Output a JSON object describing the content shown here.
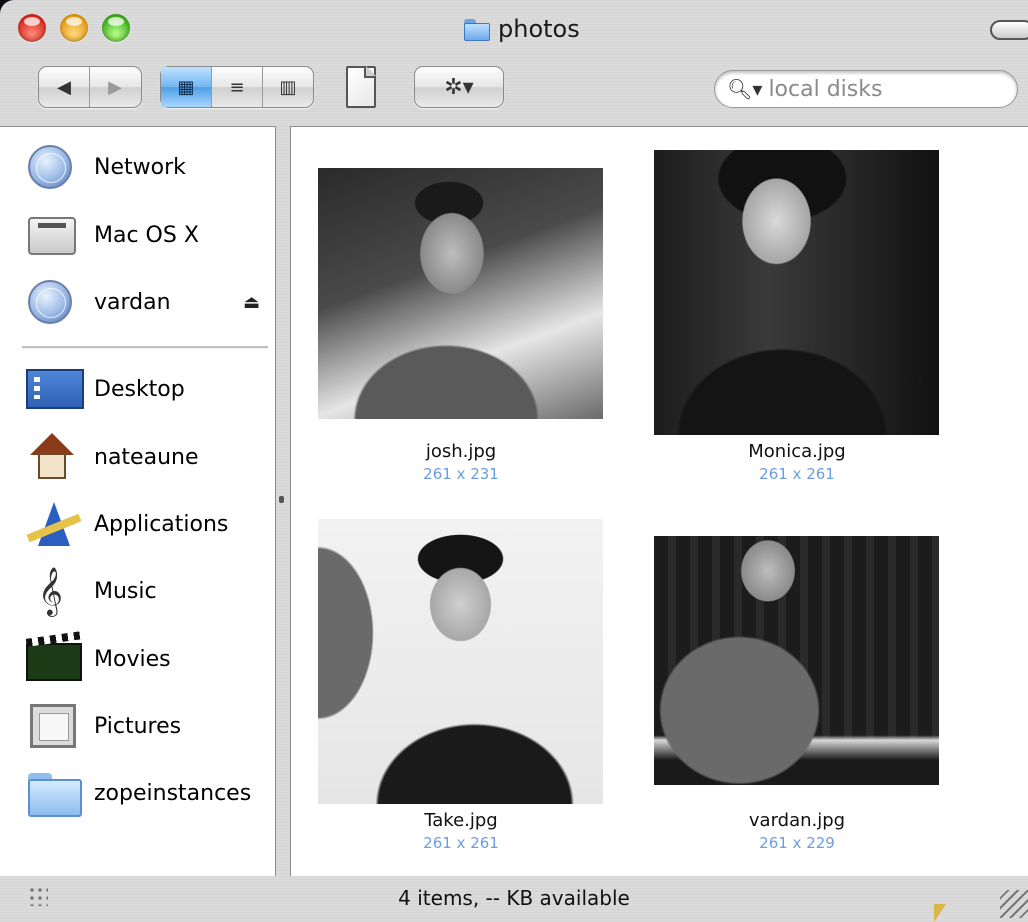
{
  "window": {
    "title": "photos"
  },
  "toolbar": {
    "back_glyph": "◀",
    "forward_glyph": "▶",
    "view_icon_glyph": "▦",
    "view_list_glyph": "≡",
    "view_column_glyph": "▥",
    "action_glyph": "✲▾",
    "search_placeholder": "local disks",
    "search_glyph": "🔍︎▾"
  },
  "sidebar": {
    "devices": [
      {
        "label": "Network",
        "icon": "network-globe-icon"
      },
      {
        "label": "Mac OS X",
        "icon": "hard-disk-icon"
      },
      {
        "label": "vardan",
        "icon": "server-globe-icon",
        "eject": "⏏"
      }
    ],
    "places": [
      {
        "label": "Desktop",
        "icon": "desktop-icon"
      },
      {
        "label": "nateaune",
        "icon": "home-icon"
      },
      {
        "label": "Applications",
        "icon": "applications-icon"
      },
      {
        "label": "Music",
        "icon": "music-icon"
      },
      {
        "label": "Movies",
        "icon": "movies-icon"
      },
      {
        "label": "Pictures",
        "icon": "pictures-icon"
      },
      {
        "label": "zopeinstances",
        "icon": "folder-icon"
      }
    ]
  },
  "files": [
    {
      "name": "josh.jpg",
      "dims": "261 x 231"
    },
    {
      "name": "Monica.jpg",
      "dims": "261 x 261"
    },
    {
      "name": "Take.jpg",
      "dims": "261 x 261"
    },
    {
      "name": "vardan.jpg",
      "dims": "261 x 229"
    }
  ],
  "status": {
    "text": "4 items, -- KB available"
  },
  "colors": {
    "selection_blue": "#5ba4ec",
    "dims_text": "#6a9ee2"
  }
}
